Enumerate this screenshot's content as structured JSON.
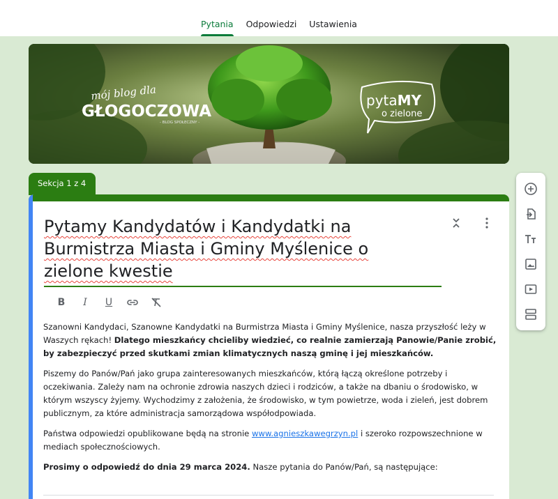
{
  "tabs": [
    {
      "label": "Pytania",
      "active": true
    },
    {
      "label": "Odpowiedzi",
      "active": false
    },
    {
      "label": "Ustawienia",
      "active": false
    }
  ],
  "banner": {
    "blog_line1": "mój blog dla",
    "blog_line2": "GŁOGOCZOWA",
    "blog_line3": "- BLOG SPOŁECZNY -",
    "badge_line1_a": "pyta",
    "badge_line1_b": "MY",
    "badge_line2": "o zielone"
  },
  "section": {
    "label": "Sekcja 1 z 4"
  },
  "form": {
    "title_line1": "Pytamy Kandydatów i Kandydatki na",
    "title_line2": "Burmistrza Miasta i Gminy Myślenice o",
    "title_line3": "zielone kwestie"
  },
  "format_bar": {
    "bold": "B",
    "italic": "I",
    "underline": "U"
  },
  "description": {
    "p1_start": "Szanowni Kandydaci, Szanowne Kandydatki na Burmistrza Miasta i Gminy Myślenice, nasza przyszłość leży w Waszych rękach! ",
    "p1_bold": "Dlatego mieszkańcy chcieliby wiedzieć, co realnie zamierzają Panowie/Panie zrobić, by zabezpieczyć przed skutkami zmian klimatycznych naszą gminę i jej mieszkańców.",
    "p2": "Piszemy do Panów/Pań jako grupa zainteresowanych mieszkańców, którą łączą określone potrzeby i oczekiwania. Zależy nam na ochronie zdrowia naszych dzieci i rodziców, a także na dbaniu o środowisko, w którym wszyscy żyjemy. Wychodzimy z założenia, że środowisko, w tym powietrze, woda i zieleń, jest dobrem publicznym, za które administracja samorządowa współodpowiada.",
    "p3_start": "Państwa odpowiedzi opublikowane będą na stronie ",
    "p3_link": "www.agnieszkawegrzyn.pl",
    "p3_end": " i szeroko rozpowszechnione w mediach społecznościowych.",
    "p4_bold": "Prosimy o odpowiedź do dnia 29 marca 2024.",
    "p4_end": " Nasze pytania do Panów/Pań, są następujące:"
  },
  "side_toolbar": [
    {
      "icon": "add-question-icon"
    },
    {
      "icon": "import-questions-icon"
    },
    {
      "icon": "add-title-icon"
    },
    {
      "icon": "add-image-icon"
    },
    {
      "icon": "add-video-icon"
    },
    {
      "icon": "add-section-icon"
    }
  ],
  "colors": {
    "accent": "#2b7d12",
    "active_tab": "#0b7b3a",
    "background": "#d9ead3",
    "focus_bar": "#4285f4",
    "link": "#1a73e8"
  }
}
